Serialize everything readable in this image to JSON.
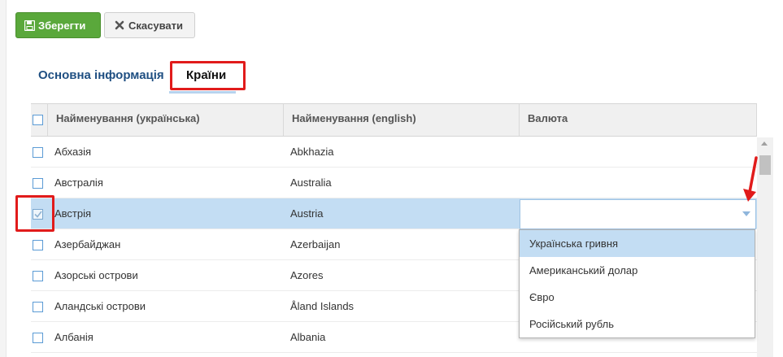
{
  "toolbar": {
    "save_label": "Зберегти",
    "cancel_label": "Скасувати"
  },
  "tabs": [
    {
      "label": "Основна інформація"
    },
    {
      "label": "Країни"
    }
  ],
  "grid": {
    "columns": [
      "Найменування (українська)",
      "Найменування (english)",
      "Валюта"
    ],
    "rows": [
      {
        "uk": "Абхазія",
        "en": "Abkhazia",
        "checked": false
      },
      {
        "uk": "Австралія",
        "en": "Australia",
        "checked": false
      },
      {
        "uk": "Австрія",
        "en": "Austria",
        "checked": true
      },
      {
        "uk": "Азербайджан",
        "en": "Azerbaijan",
        "checked": false
      },
      {
        "uk": "Азорські острови",
        "en": "Azores",
        "checked": false
      },
      {
        "uk": "Аландські острови",
        "en": "Åland Islands",
        "checked": false
      },
      {
        "uk": "Албанія",
        "en": "Albania",
        "checked": false
      }
    ]
  },
  "currency_editor": {
    "value": "",
    "options": [
      "Українська гривня",
      "Американський долар",
      "Євро",
      "Російський рубль"
    ]
  },
  "colors": {
    "save_button": "#5aa83b",
    "selected_row": "#c3ddf3",
    "tab_active_text": "#1f4f82",
    "annotation": "#e11b1b"
  }
}
